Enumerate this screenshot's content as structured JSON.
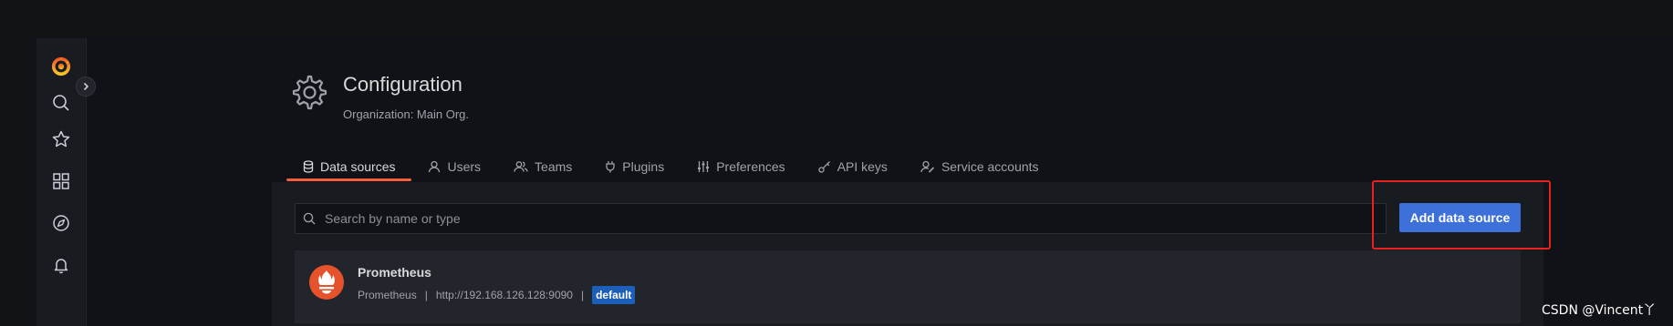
{
  "header": {
    "title": "Configuration",
    "subtitle": "Organization: Main Org."
  },
  "tabs": [
    {
      "label": "Data sources",
      "icon": "database-icon",
      "active": true
    },
    {
      "label": "Users",
      "icon": "user-icon"
    },
    {
      "label": "Teams",
      "icon": "users-icon"
    },
    {
      "label": "Plugins",
      "icon": "plug-icon"
    },
    {
      "label": "Preferences",
      "icon": "sliders-icon"
    },
    {
      "label": "API keys",
      "icon": "key-icon"
    },
    {
      "label": "Service accounts",
      "icon": "user-cog-icon"
    }
  ],
  "search": {
    "placeholder": "Search by name or type",
    "value": ""
  },
  "actions": {
    "add_label": "Add data source"
  },
  "datasources": [
    {
      "name": "Prometheus",
      "type": "Prometheus",
      "separator": "|",
      "url": "http://192.168.126.128:9090",
      "badge": "default"
    }
  ],
  "sidebar": {
    "icons": [
      "grafana-logo",
      "search-icon",
      "star-icon",
      "dashboards-icon",
      "explore-icon",
      "alerting-icon"
    ]
  },
  "watermark": "CSDN @Vincent丫",
  "colors": {
    "accent": "#3d71d9",
    "active_tab": "#f55f3e",
    "highlight_box": "#e8231f",
    "prometheus": "#e6522c",
    "badge": "#1c5fb8"
  }
}
